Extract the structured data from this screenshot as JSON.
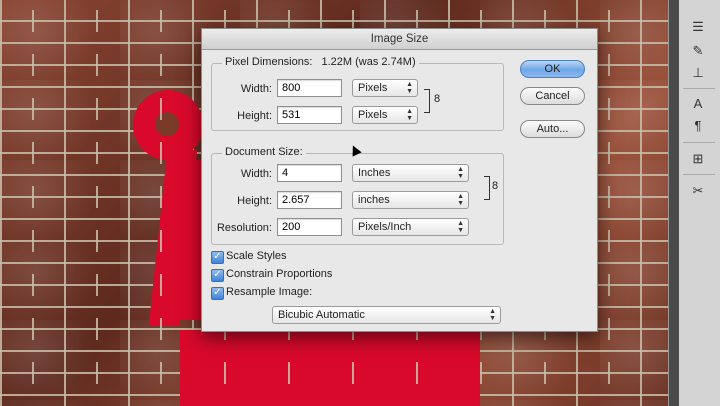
{
  "dialog": {
    "title": "Image Size",
    "pixel_dimensions": {
      "legend": "Pixel Dimensions:",
      "size_text": "1.22M (was 2.74M)",
      "width_label": "Width:",
      "width_value": "800",
      "width_unit": "Pixels",
      "height_label": "Height:",
      "height_value": "531",
      "height_unit": "Pixels"
    },
    "document_size": {
      "legend": "Document Size:",
      "width_label": "Width:",
      "width_value": "4",
      "width_unit": "Inches",
      "height_label": "Height:",
      "height_value": "2.657",
      "height_unit": "inches",
      "resolution_label": "Resolution:",
      "resolution_value": "200",
      "resolution_unit": "Pixels/Inch"
    },
    "options": {
      "scale_styles": "Scale Styles",
      "constrain_proportions": "Constrain Proportions",
      "resample_image": "Resample Image:",
      "resample_method": "Bicubic Automatic"
    },
    "buttons": {
      "ok": "OK",
      "cancel": "Cancel",
      "auto": "Auto..."
    }
  },
  "toolpanel": {
    "tools": [
      "sliders-icon",
      "brush-icon",
      "stamp-icon",
      "text-icon",
      "paragraph-icon",
      "grid-icon",
      "scissors-icon"
    ]
  },
  "colors": {
    "accent": "#d9092b",
    "default_button": "#6ea6e6"
  }
}
